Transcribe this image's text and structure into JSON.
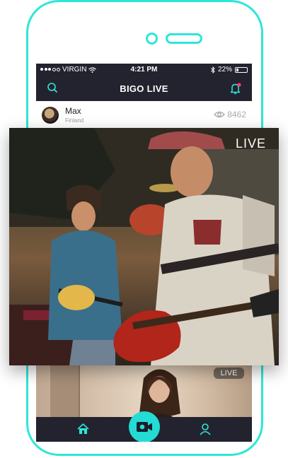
{
  "status_bar": {
    "carrier": "VIRGIN",
    "time": "4:21 PM",
    "battery_percent": "22%",
    "battery_level": 0.22
  },
  "app_bar": {
    "title": "BIGO LIVE",
    "search_icon": "search-icon",
    "bell_icon": "bell-icon"
  },
  "stream_item": {
    "name": "Max",
    "location": "Finland",
    "viewer_count": "8462",
    "viewer_icon": "eye-icon"
  },
  "featured": {
    "badge": "LIVE"
  },
  "second_stream": {
    "badge": "LIVE"
  },
  "tab_bar": {
    "home_icon": "home-icon",
    "camera_icon": "video-camera-icon",
    "profile_icon": "user-icon"
  },
  "colors": {
    "accent": "#2de6d9",
    "dark_bar": "#23232f"
  }
}
